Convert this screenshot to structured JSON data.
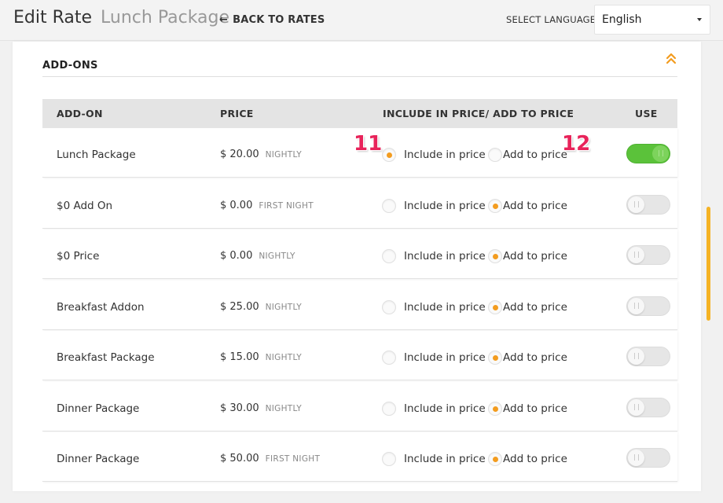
{
  "header": {
    "title": "Edit Rate",
    "subtitle": "Lunch Package",
    "back_arrow": "←",
    "back_label": "BACK TO RATES",
    "language_label": "SELECT LANGUAGE",
    "language_value": "English"
  },
  "section": {
    "title": "ADD-ONS",
    "collapse_icon": "double-chevron-up-icon"
  },
  "columns": {
    "addon": "ADD-ON",
    "price": "PRICE",
    "mode": "INCLUDE IN PRICE/ ADD TO PRICE",
    "use": "USE"
  },
  "labels": {
    "include": "Include in price",
    "add": "Add to price"
  },
  "rows": [
    {
      "name": "Lunch Package",
      "price": "$ 20.00",
      "freq": "NIGHTLY",
      "mode": "include",
      "use": true
    },
    {
      "name": "$0 Add On",
      "price": "$ 0.00",
      "freq": "FIRST NIGHT",
      "mode": "add",
      "use": false
    },
    {
      "name": "$0 Price",
      "price": "$ 0.00",
      "freq": "NIGHTLY",
      "mode": "add",
      "use": false
    },
    {
      "name": "Breakfast Addon",
      "price": "$ 25.00",
      "freq": "NIGHTLY",
      "mode": "add",
      "use": false
    },
    {
      "name": "Breakfast Package",
      "price": "$ 15.00",
      "freq": "NIGHTLY",
      "mode": "add",
      "use": false
    },
    {
      "name": "Dinner Package",
      "price": "$ 30.00",
      "freq": "NIGHTLY",
      "mode": "add",
      "use": false
    },
    {
      "name": "Dinner Package",
      "price": "$ 50.00",
      "freq": "FIRST NIGHT",
      "mode": "add",
      "use": false
    }
  ],
  "markers": [
    "11",
    "12"
  ],
  "colors": {
    "accent": "#f39c1f",
    "toggle_on": "#5bc23a",
    "marker": "#e8235a",
    "scrollbar": "#f5b324"
  }
}
